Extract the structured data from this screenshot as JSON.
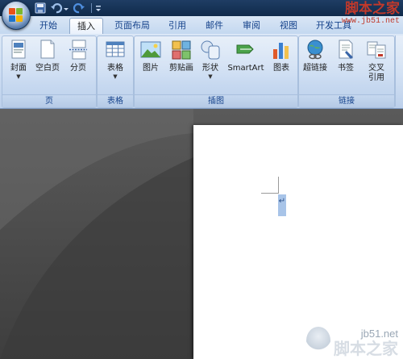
{
  "quick_access": {
    "save_icon": "save-icon",
    "undo_icon": "undo-icon",
    "redo_icon": "redo-icon",
    "customize_icon": "customize-dropdown-icon"
  },
  "tabs": [
    {
      "label": "开始",
      "active": false
    },
    {
      "label": "插入",
      "active": true
    },
    {
      "label": "页面布局",
      "active": false
    },
    {
      "label": "引用",
      "active": false
    },
    {
      "label": "邮件",
      "active": false
    },
    {
      "label": "审阅",
      "active": false
    },
    {
      "label": "视图",
      "active": false
    },
    {
      "label": "开发工具",
      "active": false
    }
  ],
  "ribbon": {
    "groups": [
      {
        "label": "页",
        "commands": [
          {
            "label": "封面",
            "icon": "cover-page-icon",
            "dropdown": true
          },
          {
            "label": "空白页",
            "icon": "blank-page-icon",
            "dropdown": false
          },
          {
            "label": "分页",
            "icon": "page-break-icon",
            "dropdown": false
          }
        ]
      },
      {
        "label": "表格",
        "commands": [
          {
            "label": "表格",
            "icon": "table-icon",
            "dropdown": true
          }
        ]
      },
      {
        "label": "插图",
        "commands": [
          {
            "label": "图片",
            "icon": "picture-icon",
            "dropdown": false
          },
          {
            "label": "剪贴画",
            "icon": "clip-art-icon",
            "dropdown": false
          },
          {
            "label": "形状",
            "icon": "shapes-icon",
            "dropdown": true
          },
          {
            "label": "SmartArt",
            "icon": "smartart-icon",
            "dropdown": false
          },
          {
            "label": "图表",
            "icon": "chart-icon",
            "dropdown": false
          }
        ]
      },
      {
        "label": "链接",
        "commands": [
          {
            "label": "超链接",
            "icon": "hyperlink-icon",
            "dropdown": false
          },
          {
            "label": "书签",
            "icon": "bookmark-icon",
            "dropdown": false
          },
          {
            "label": "交叉引用",
            "label_line1": "交叉",
            "label_line2": "引用",
            "icon": "cross-reference-icon",
            "dropdown": false
          }
        ]
      }
    ]
  },
  "document": {
    "paragraph_mark": "↵"
  },
  "watermark": {
    "top_title": "脚本之家",
    "top_url": "www.jb51.net",
    "bottom_url": "jb51.net",
    "bottom_title": "脚本之家"
  },
  "colors": {
    "accent_text": "#15428b",
    "ribbon_bg": "#cbdcf2",
    "watermark_red": "#c0392b"
  }
}
